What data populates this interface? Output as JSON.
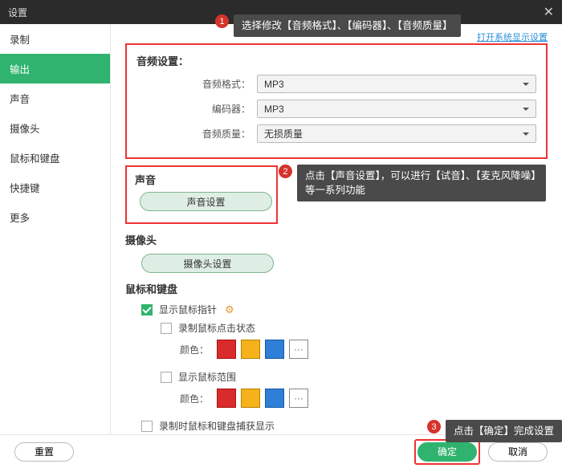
{
  "titlebar": {
    "title": "设置",
    "close": "✕"
  },
  "sidebar": {
    "items": [
      {
        "label": "录制"
      },
      {
        "label": "输出"
      },
      {
        "label": "声音"
      },
      {
        "label": "摄像头"
      },
      {
        "label": "鼠标和键盘"
      },
      {
        "label": "快捷键"
      },
      {
        "label": "更多"
      }
    ],
    "active_index": 1
  },
  "top_link": "打开系统显示设置",
  "audio": {
    "section_title": "音频设置：",
    "format_label": "音频格式：",
    "format_value": "MP3",
    "encoder_label": "编码器：",
    "encoder_value": "MP3",
    "quality_label": "音频质量：",
    "quality_value": "无损质量"
  },
  "sound": {
    "section_title": "声音",
    "button": "声音设置"
  },
  "camera": {
    "section_title": "摄像头",
    "button": "摄像头设置"
  },
  "mk": {
    "section_title": "鼠标和键盘",
    "show_cursor": "显示鼠标指针",
    "record_click": "录制鼠标点击状态",
    "color_label": "颜色：",
    "more": "···",
    "show_range": "显示鼠标范围",
    "record_mk_capture": "录制时鼠标和键盘捕获显示"
  },
  "footer": {
    "reset": "重置",
    "ok": "确定",
    "cancel": "取消"
  },
  "callouts": {
    "c1": "选择修改【音频格式】、【编码器】、【音频质量】",
    "c2": "点击【声音设置】，可以进行【试音】、【麦克风降噪】等一系列功能",
    "c3": "点击【确定】完成设置"
  }
}
